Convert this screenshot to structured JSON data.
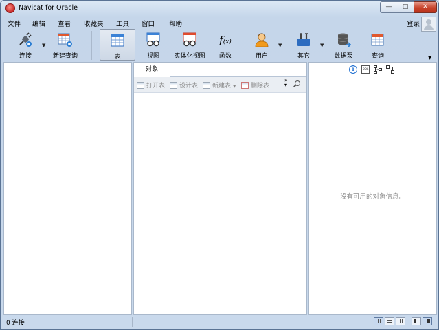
{
  "window": {
    "title": "Navicat for Oracle"
  },
  "menu": [
    "文件",
    "编辑",
    "查看",
    "收藏夹",
    "工具",
    "窗口",
    "帮助"
  ],
  "account": {
    "login_label": "登录"
  },
  "toolbar": {
    "connect": "连接",
    "new_query": "新建查询",
    "table": "表",
    "view": "视图",
    "materialized_view": "实体化视图",
    "function": "函数",
    "user": "用户",
    "other": "其它",
    "datapump": "数据泵",
    "query": "查询"
  },
  "object_panel": {
    "tab_label": "对象",
    "actions": {
      "open_table": "打开表",
      "design_table": "设计表",
      "new_table": "新建表",
      "delete_table": "删除表"
    }
  },
  "info_panel": {
    "empty_message": "没有可用的对象信息。"
  },
  "status": {
    "connections": "0 连接"
  },
  "colors": {
    "chrome": "#c9d9ec",
    "pane_border": "#a9b8cb",
    "close_button": "#c8432b",
    "info_icon": "#1f6fd1",
    "muted_text": "#8c8c8c"
  }
}
